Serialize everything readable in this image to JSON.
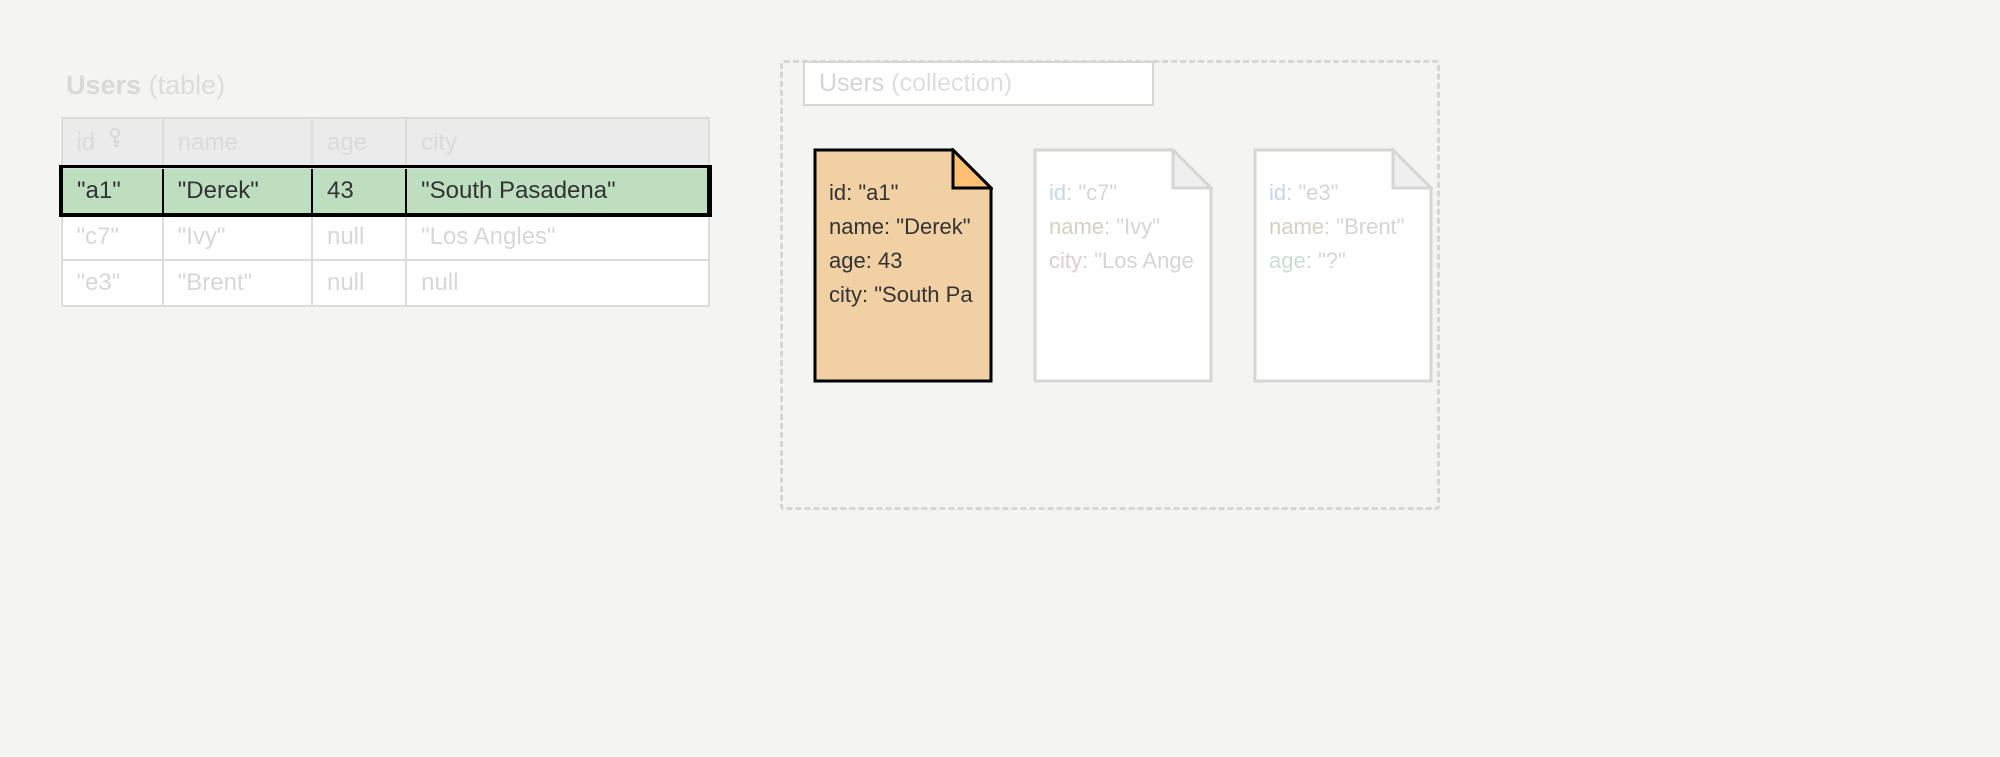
{
  "table": {
    "title": "Users",
    "subtitle": "(table)",
    "columns": [
      "id",
      "name",
      "age",
      "city"
    ],
    "rows": [
      {
        "id": "\"a1\"",
        "name": "\"Derek\"",
        "age": "43",
        "city": "\"South Pasadena\"",
        "highlighted": true
      },
      {
        "id": "\"c7\"",
        "name": "\"Ivy\"",
        "age": "null",
        "city": "\"Los Angles\"",
        "highlighted": false
      },
      {
        "id": "\"e3\"",
        "name": "\"Brent\"",
        "age": "null",
        "city": "null",
        "highlighted": false
      }
    ]
  },
  "collection": {
    "title": "Users",
    "subtitle": "(collection)",
    "keys": {
      "id": "id",
      "name": "name",
      "age": "age",
      "city": "city"
    },
    "docs": [
      {
        "highlighted": true,
        "fields": {
          "id": "\"a1\"",
          "name": "\"Derek\"",
          "age": "43",
          "city": "\"South Pa"
        }
      },
      {
        "highlighted": false,
        "fields": {
          "id": "\"c7\"",
          "name": "\"Ivy\"",
          "city": "\"Los Ange"
        }
      },
      {
        "highlighted": false,
        "fields": {
          "id": "\"e3\"",
          "name": "\"Brent\"",
          "age": "\"?\""
        }
      }
    ]
  }
}
